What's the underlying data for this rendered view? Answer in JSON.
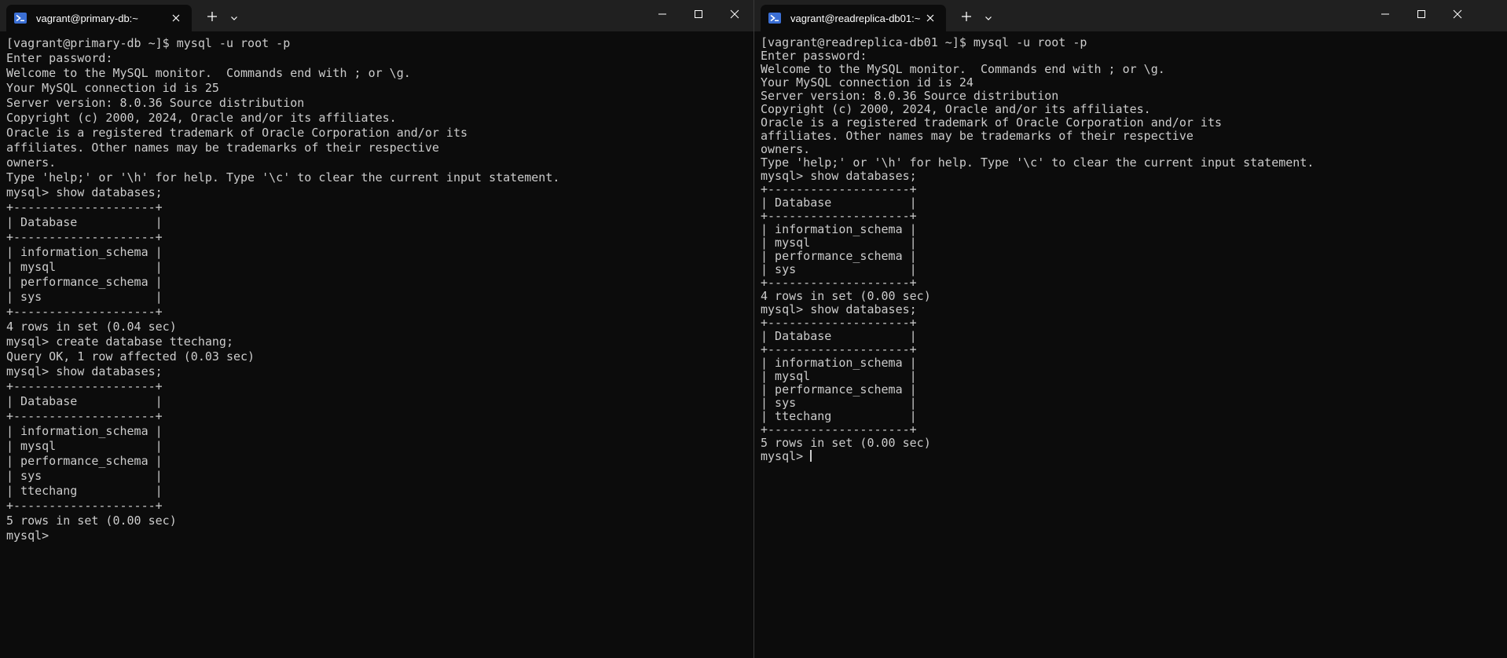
{
  "left": {
    "tab_title": "vagrant@primary-db:~",
    "lines": [
      "[vagrant@primary-db ~]$ mysql -u root -p",
      "Enter password:",
      "Welcome to the MySQL monitor.  Commands end with ; or \\g.",
      "Your MySQL connection id is 25",
      "Server version: 8.0.36 Source distribution",
      "",
      "Copyright (c) 2000, 2024, Oracle and/or its affiliates.",
      "",
      "Oracle is a registered trademark of Oracle Corporation and/or its",
      "affiliates. Other names may be trademarks of their respective",
      "owners.",
      "",
      "Type 'help;' or '\\h' for help. Type '\\c' to clear the current input statement.",
      "",
      "mysql> show databases;",
      "+--------------------+",
      "| Database           |",
      "+--------------------+",
      "| information_schema |",
      "| mysql              |",
      "| performance_schema |",
      "| sys                |",
      "+--------------------+",
      "4 rows in set (0.04 sec)",
      "",
      "mysql> create database ttechang;",
      "Query OK, 1 row affected (0.03 sec)",
      "",
      "mysql> show databases;",
      "+--------------------+",
      "| Database           |",
      "+--------------------+",
      "| information_schema |",
      "| mysql              |",
      "| performance_schema |",
      "| sys                |",
      "| ttechang           |",
      "+--------------------+",
      "5 rows in set (0.00 sec)",
      "",
      "mysql>"
    ]
  },
  "right": {
    "tab_title": "vagrant@readreplica-db01:~",
    "lines": [
      "[vagrant@readreplica-db01 ~]$ mysql -u root -p",
      "Enter password:",
      "Welcome to the MySQL monitor.  Commands end with ; or \\g.",
      "Your MySQL connection id is 24",
      "Server version: 8.0.36 Source distribution",
      "",
      "Copyright (c) 2000, 2024, Oracle and/or its affiliates.",
      "",
      "Oracle is a registered trademark of Oracle Corporation and/or its",
      "affiliates. Other names may be trademarks of their respective",
      "owners.",
      "",
      "Type 'help;' or '\\h' for help. Type '\\c' to clear the current input statement.",
      "",
      "mysql> show databases;",
      "+--------------------+",
      "| Database           |",
      "+--------------------+",
      "| information_schema |",
      "| mysql              |",
      "| performance_schema |",
      "| sys                |",
      "+--------------------+",
      "4 rows in set (0.00 sec)",
      "",
      "mysql> show databases;",
      "+--------------------+",
      "| Database           |",
      "+--------------------+",
      "| information_schema |",
      "| mysql              |",
      "| performance_schema |",
      "| sys                |",
      "| ttechang           |",
      "+--------------------+",
      "5 rows in set (0.00 sec)",
      "",
      "mysql> "
    ]
  },
  "icons": {
    "tab": "powershell-icon",
    "close": "close-icon",
    "new_tab": "plus-icon",
    "dropdown": "chevron-down-icon",
    "minimize": "minimize-icon",
    "maximize": "maximize-icon",
    "window_close": "window-close-icon"
  },
  "colors": {
    "terminal_bg": "#0c0c0c",
    "titlebar_bg": "#202020",
    "text": "#cccccc",
    "tab_icon": "#3b6fd4"
  }
}
